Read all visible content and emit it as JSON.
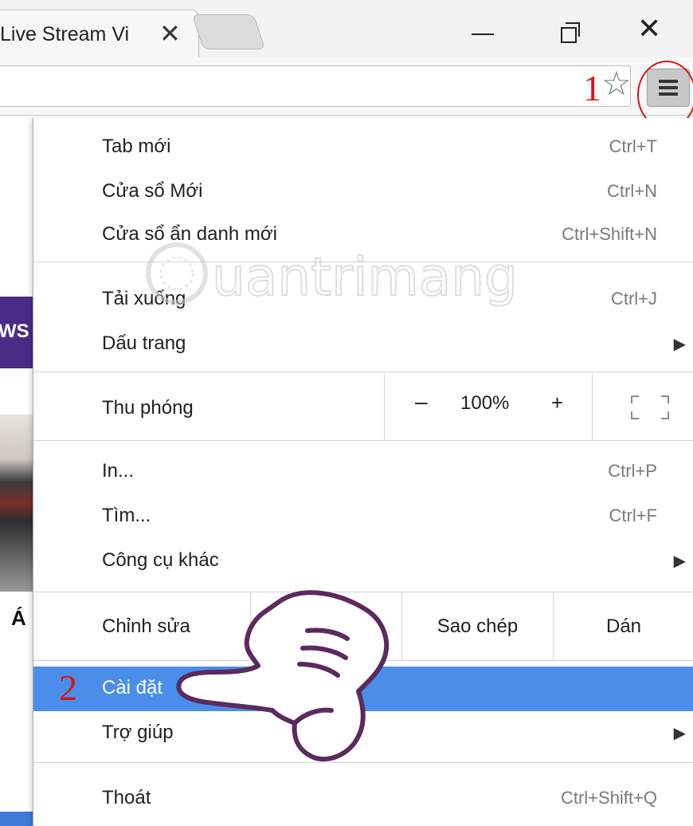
{
  "browser": {
    "tab_title": "Live Stream Vi",
    "tab_close_glyph": "✕",
    "window_close_glyph": "✕",
    "bookmark_star_glyph": "☆"
  },
  "annotations": {
    "step1": "1",
    "step2": "2"
  },
  "page_fragment": {
    "banner_text": "WS",
    "below_photo_char": "Á"
  },
  "menu": {
    "groups": [
      [
        {
          "label": "Tab mới",
          "shortcut": "Ctrl+T"
        },
        {
          "label": "Cửa sổ Mới",
          "shortcut": "Ctrl+N"
        },
        {
          "label": "Cửa sổ ẩn danh mới",
          "shortcut": "Ctrl+Shift+N"
        }
      ],
      [
        {
          "label": "Tải xuống",
          "shortcut": "Ctrl+J"
        },
        {
          "label": "Dấu trang",
          "submenu": true
        }
      ],
      [
        {
          "label": "In...",
          "shortcut": "Ctrl+P"
        },
        {
          "label": "Tìm...",
          "shortcut": "Ctrl+F"
        },
        {
          "label": "Công cụ khác",
          "submenu": true
        }
      ],
      [
        {
          "label": "Cài đặt",
          "selected": true
        },
        {
          "label": "Trợ giúp",
          "submenu": true
        }
      ],
      [
        {
          "label": "Thoát",
          "shortcut": "Ctrl+Shift+Q"
        }
      ]
    ],
    "zoom": {
      "label": "Thu phóng",
      "minus": "–",
      "value": "100%",
      "plus": "+"
    },
    "edit": {
      "label": "Chỉnh sửa",
      "cut": "",
      "copy": "Sao chép",
      "paste": "Dán"
    },
    "submenu_arrow": "▶"
  },
  "watermark": {
    "text": "uantrimang"
  },
  "colors": {
    "selected_bg": "#4a8eea",
    "annotation_red": "#d9141b",
    "banner_purple": "#4a2b86",
    "hand_outline": "#5b2a5e"
  }
}
